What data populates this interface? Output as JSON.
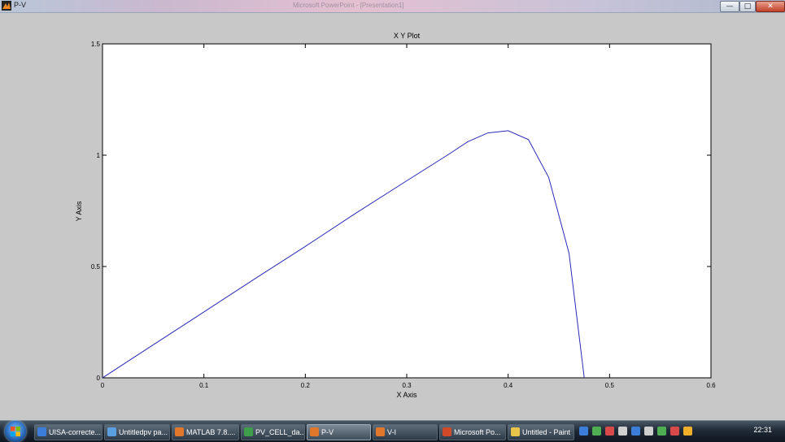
{
  "window": {
    "title": "P-V",
    "blurred_title": "Microsoft PowerPoint - [Presentation1]",
    "buttons": {
      "minimize": "—",
      "maximize": "□",
      "close": "✕"
    }
  },
  "chart_data": {
    "type": "line",
    "title": "X Y Plot",
    "xlabel": "X Axis",
    "ylabel": "Y Axis",
    "xlim": [
      0,
      0.6
    ],
    "ylim": [
      0,
      1.5
    ],
    "xticks": [
      "0",
      "0.1",
      "0.2",
      "0.3",
      "0.4",
      "0.5",
      "0.6"
    ],
    "yticks": [
      "0",
      "0.5",
      "1",
      "1.5"
    ],
    "grid": false,
    "series": [
      {
        "color": "#2a2ab8",
        "x": [
          0,
          0.05,
          0.1,
          0.15,
          0.2,
          0.25,
          0.3,
          0.34,
          0.36,
          0.38,
          0.4,
          0.42,
          0.44,
          0.46,
          0.475
        ],
        "y": [
          0,
          0.148,
          0.296,
          0.444,
          0.59,
          0.74,
          0.885,
          1.0,
          1.06,
          1.1,
          1.11,
          1.07,
          0.9,
          0.56,
          0.0
        ]
      }
    ]
  },
  "taskbar": {
    "items": [
      {
        "label": "UISA-correcte...",
        "icon_color": "#3b7dd8"
      },
      {
        "label": "Untitledpv pa...",
        "icon_color": "#5aa0e0"
      },
      {
        "label": "MATLAB 7.8....",
        "icon_color": "#e0772a"
      },
      {
        "label": "PV_CELL_da...",
        "icon_color": "#3f9e4a"
      },
      {
        "label": "P-V",
        "icon_color": "#e0772a"
      },
      {
        "label": "V-I",
        "icon_color": "#e0772a"
      },
      {
        "label": "Microsoft Po...",
        "icon_color": "#d04a2a"
      },
      {
        "label": "Untitled - Paint",
        "icon_color": "#e8c44a"
      }
    ],
    "clock": "22:31",
    "tray_icons": [
      "network-icon",
      "volume-icon",
      "bluetooth-icon",
      "battery-icon",
      "shield-icon",
      "flag-icon",
      "update-icon",
      "printer-icon",
      "sun-icon"
    ]
  }
}
